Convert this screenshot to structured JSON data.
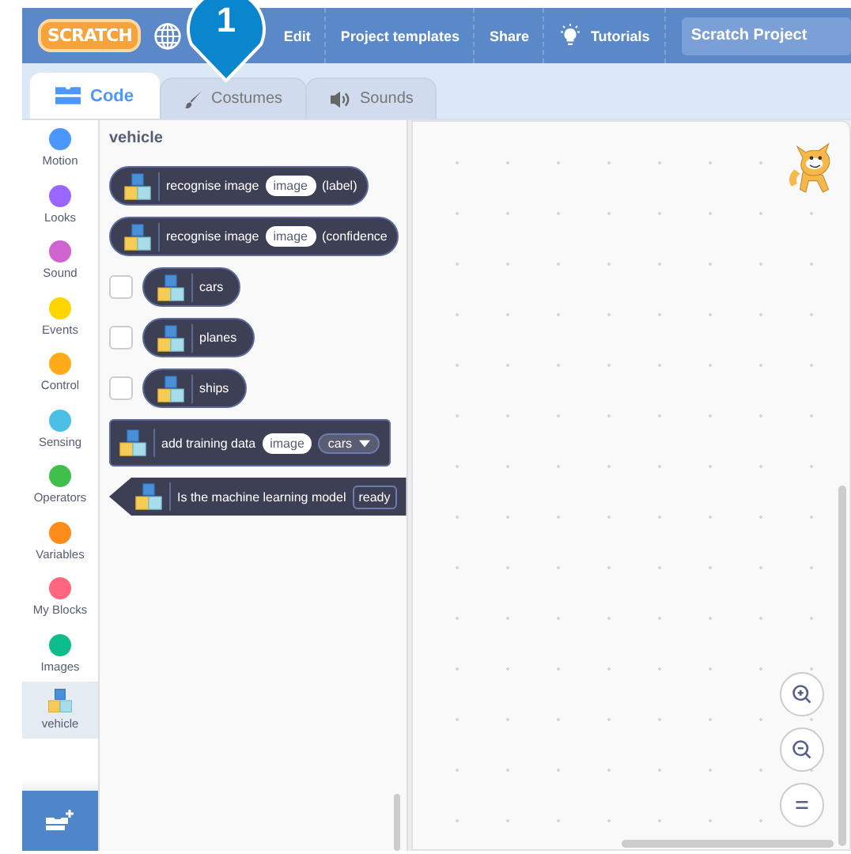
{
  "menu_bar": {
    "logo": "SCRATCH",
    "items": [
      {
        "label": "Edit",
        "kind": "text"
      },
      {
        "label": "Project templates",
        "kind": "text"
      },
      {
        "label": "Share",
        "kind": "text"
      },
      {
        "label": "Tutorials",
        "kind": "tutorials"
      }
    ],
    "project_title": "Scratch Project"
  },
  "callout": {
    "label": "1"
  },
  "tabs": [
    {
      "label": "Code",
      "kind": "code",
      "selected": true
    },
    {
      "label": "Costumes",
      "kind": "costumes",
      "selected": false
    },
    {
      "label": "Sounds",
      "kind": "sounds",
      "selected": false
    }
  ],
  "categories": [
    {
      "label": "Motion",
      "kind": "circle",
      "color": "#4c97ff",
      "selected": false
    },
    {
      "label": "Looks",
      "kind": "circle",
      "color": "#9966ff",
      "selected": false
    },
    {
      "label": "Sound",
      "kind": "circle",
      "color": "#cf63cf",
      "selected": false
    },
    {
      "label": "Events",
      "kind": "circle",
      "color": "#ffd500",
      "selected": false
    },
    {
      "label": "Control",
      "kind": "circle",
      "color": "#ffab19",
      "selected": false
    },
    {
      "label": "Sensing",
      "kind": "circle",
      "color": "#4cbfe6",
      "selected": false
    },
    {
      "label": "Operators",
      "kind": "circle",
      "color": "#40bf4a",
      "selected": false
    },
    {
      "label": "Variables",
      "kind": "circle",
      "color": "#ff8c1a",
      "selected": false
    },
    {
      "label": "My Blocks",
      "kind": "circle",
      "color": "#ff6680",
      "selected": false
    },
    {
      "label": "Images",
      "kind": "circle",
      "color": "#0fbd8c",
      "selected": false
    },
    {
      "label": "vehicle",
      "kind": "extension",
      "selected": true
    }
  ],
  "palette": {
    "title": "vehicle",
    "blocks": [
      {
        "kind": "reporter",
        "parts": [
          {
            "kind": "text",
            "text": "recognise image"
          },
          {
            "kind": "input",
            "text": "image"
          },
          {
            "kind": "text",
            "text": "(label)"
          }
        ]
      },
      {
        "kind": "reporter",
        "parts": [
          {
            "kind": "text",
            "text": "recognise image"
          },
          {
            "kind": "input",
            "text": "image"
          },
          {
            "kind": "text",
            "text": "(confidence"
          }
        ]
      },
      {
        "kind": "variable",
        "checked": false,
        "parts": [
          {
            "kind": "text",
            "text": "cars"
          }
        ]
      },
      {
        "kind": "variable",
        "checked": false,
        "parts": [
          {
            "kind": "text",
            "text": "planes"
          }
        ]
      },
      {
        "kind": "variable",
        "checked": false,
        "parts": [
          {
            "kind": "text",
            "text": "ships"
          }
        ]
      },
      {
        "kind": "command",
        "parts": [
          {
            "kind": "text",
            "text": "add training data"
          },
          {
            "kind": "input",
            "text": "image"
          },
          {
            "kind": "dropdown",
            "text": "cars"
          }
        ]
      },
      {
        "kind": "boolean",
        "parts": [
          {
            "kind": "text",
            "text": "Is the machine learning model"
          },
          {
            "kind": "outline",
            "text": "ready"
          }
        ]
      }
    ]
  }
}
